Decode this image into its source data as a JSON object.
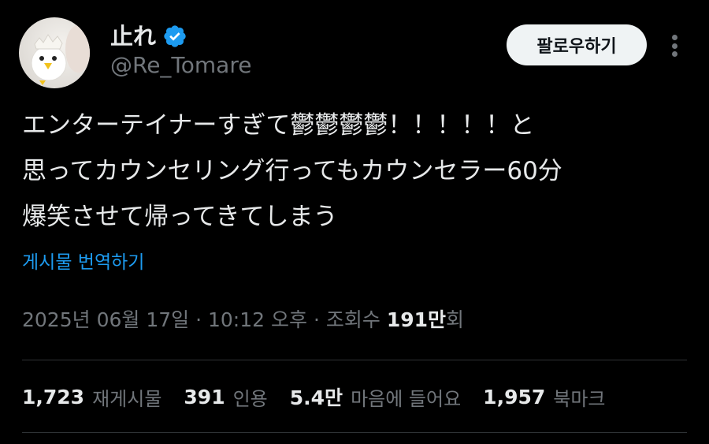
{
  "author": {
    "display_name": "止れ",
    "handle": "@Re_Tomare",
    "verified": true,
    "avatar_icon": "chick-in-eggshell-avatar",
    "verified_icon": "verified-badge-icon",
    "verified_color": "#1d9bf0"
  },
  "header": {
    "follow_label": "팔로우하기",
    "more_icon": "more-vertical-icon"
  },
  "tweet": {
    "lines": [
      "エンターテイナーすぎて鬱鬱鬱鬱！！！！！と",
      "思ってカウンセリング行ってもカウンセラー60分",
      "爆笑させて帰ってきてしまう"
    ],
    "translate_label": "게시물 번역하기"
  },
  "meta": {
    "date": "2025년 06월 17일",
    "separator": "·",
    "time": "10:12 오후",
    "views_label": "조회수",
    "views_count": "191만",
    "views_suffix": "회"
  },
  "stats": [
    {
      "value": "1,723",
      "label": "재게시물"
    },
    {
      "value": "391",
      "label": "인용"
    },
    {
      "value": "5.4만",
      "label": "마음에 들어요"
    },
    {
      "value": "1,957",
      "label": "북마크"
    }
  ],
  "colors": {
    "background": "#000000",
    "text_primary": "#e7e9ea",
    "text_secondary": "#71767b",
    "link": "#1d9bf0",
    "follow_button_bg": "#eff3f4",
    "divider": "#2f3336"
  }
}
